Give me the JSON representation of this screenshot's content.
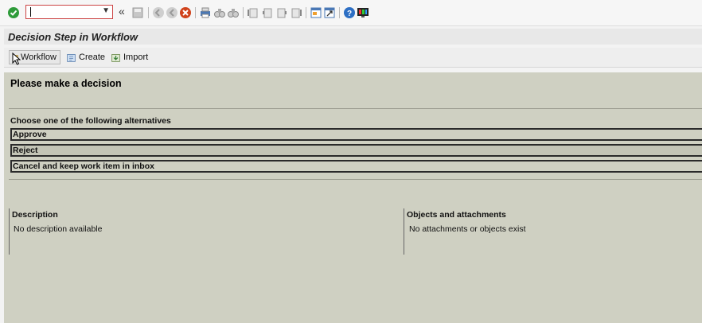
{
  "toolbar": {
    "command_field_value": "",
    "icons": [
      "check-icon",
      "dropdown-icon",
      "double-left-icon",
      "save-icon",
      "back-icon",
      "exit-icon",
      "cancel-icon",
      "print-icon",
      "find-icon",
      "find-next-icon",
      "first-page-icon",
      "prev-page-icon",
      "next-page-icon",
      "last-page-icon",
      "new-session-icon",
      "shortcut-icon",
      "help-icon",
      "customize-icon"
    ]
  },
  "window": {
    "title": "Decision Step in Workflow"
  },
  "app_toolbar": {
    "workflow_label": "Workflow",
    "create_label": "Create",
    "import_label": "Import"
  },
  "main": {
    "heading": "Please make a decision",
    "choose_label": "Choose one of the following alternatives",
    "alternatives": [
      "Approve",
      "Reject",
      "Cancel and keep work item in inbox"
    ],
    "description": {
      "title": "Description",
      "text": "No description available"
    },
    "objects": {
      "title": "Objects and attachments",
      "text": "No attachments or objects exist"
    }
  }
}
